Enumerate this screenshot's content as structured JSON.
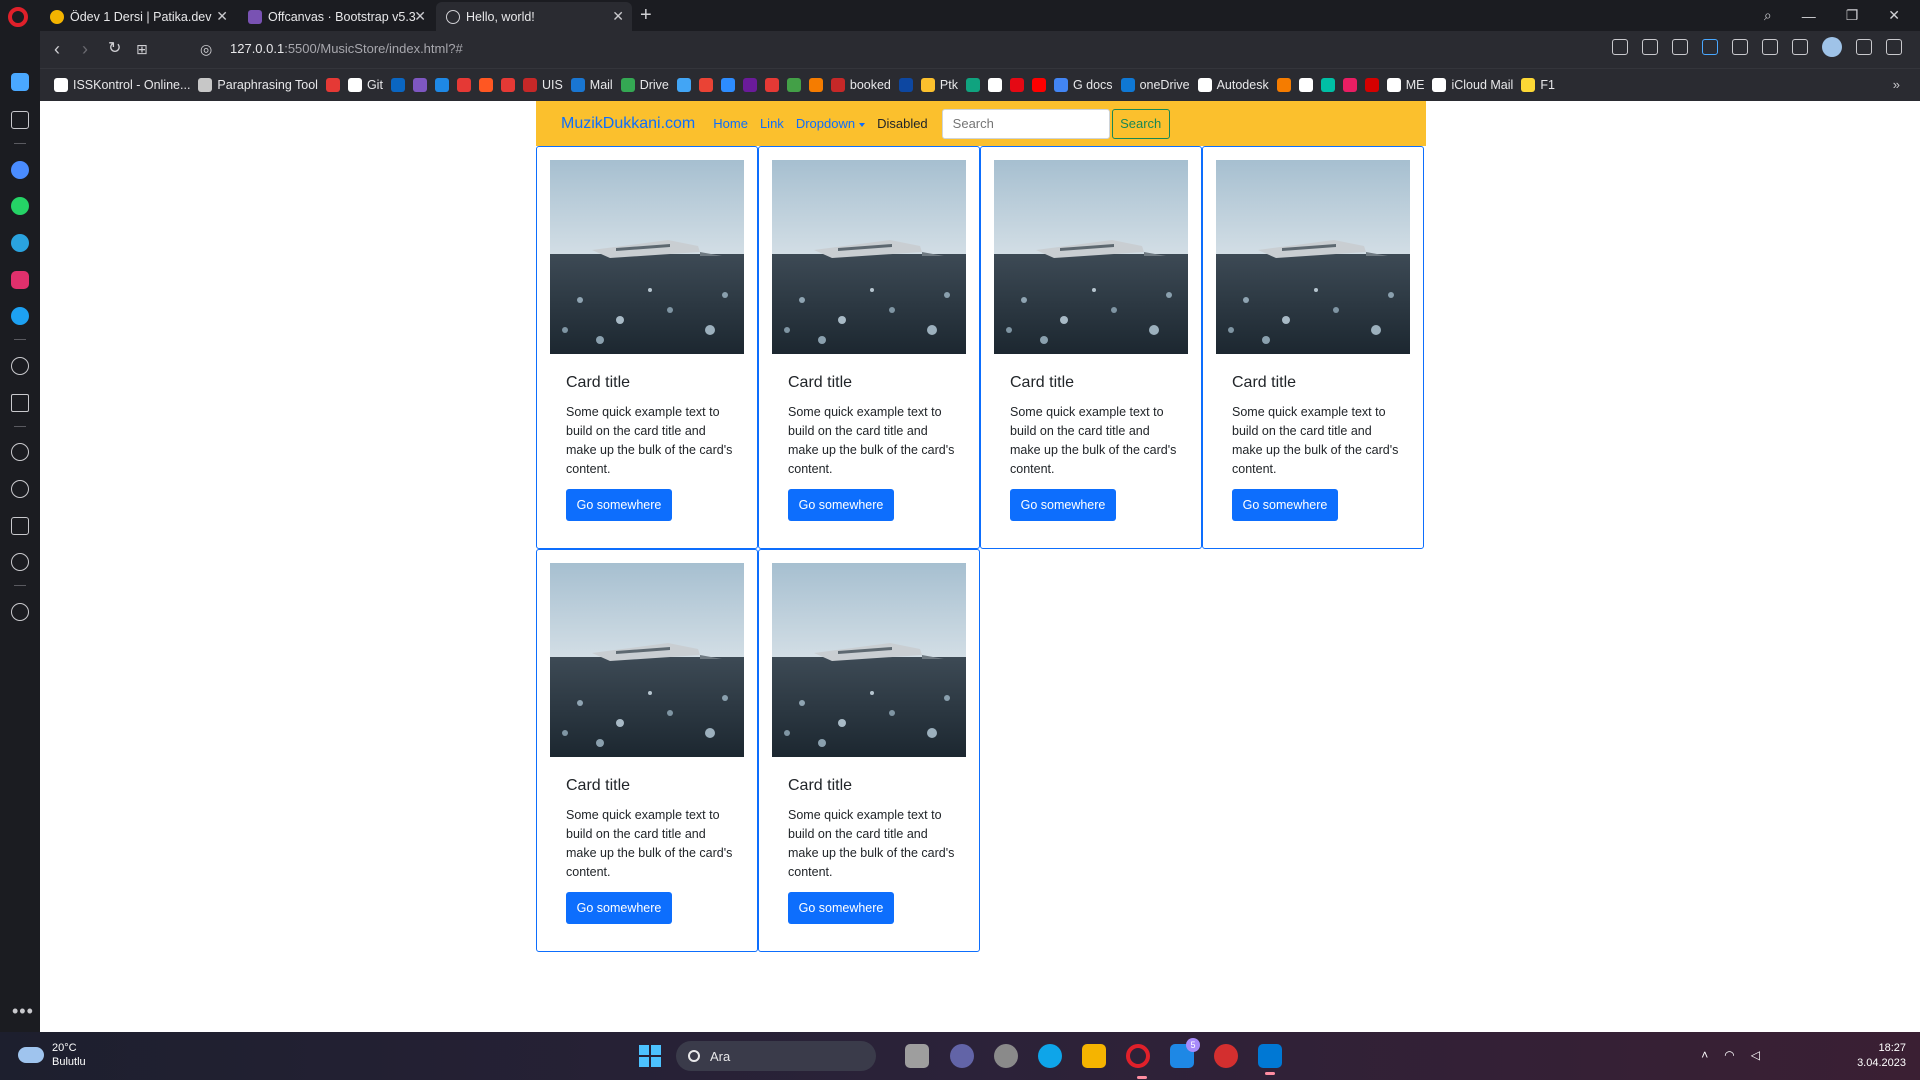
{
  "browser": {
    "tabs": [
      {
        "label": "Ödev 1 Dersi | Patika.dev",
        "favicon_color": "#f4b400",
        "active": false
      },
      {
        "label": "Offcanvas · Bootstrap v5.3",
        "favicon_color": "#7952b3",
        "active": false
      },
      {
        "label": "Hello, world!",
        "favicon_color": "#9aa0a6",
        "active": true
      }
    ],
    "url_host": "127.0.0.1",
    "url_path": ":5500/MusicStore/index.html?#",
    "bookmarks": [
      {
        "label": "ISSKontrol - Online...",
        "color": "#ffffff"
      },
      {
        "label": "Paraphrasing Tool",
        "color": "#c7c7c7"
      },
      {
        "label": "",
        "color": "#e53935"
      },
      {
        "label": "Git",
        "color": "#ffffff"
      },
      {
        "label": "",
        "color": "#0a66c2"
      },
      {
        "label": "",
        "color": "#7e57c2"
      },
      {
        "label": "",
        "color": "#1e88e5"
      },
      {
        "label": "",
        "color": "#e53935"
      },
      {
        "label": "",
        "color": "#ff5722"
      },
      {
        "label": "",
        "color": "#e53935"
      },
      {
        "label": "UIS",
        "color": "#c62828"
      },
      {
        "label": "Mail",
        "color": "#1976d2"
      },
      {
        "label": "Drive",
        "color": "#34a853"
      },
      {
        "label": "",
        "color": "#42a5f5"
      },
      {
        "label": "",
        "color": "#ea4335"
      },
      {
        "label": "",
        "color": "#2d8cff"
      },
      {
        "label": "",
        "color": "#6a1b9a"
      },
      {
        "label": "",
        "color": "#e53935"
      },
      {
        "label": "",
        "color": "#43a047"
      },
      {
        "label": "",
        "color": "#f57c00"
      },
      {
        "label": "booked",
        "color": "#c62828"
      },
      {
        "label": "",
        "color": "#0d47a1"
      },
      {
        "label": "Ptk",
        "color": "#fbc02d"
      },
      {
        "label": "",
        "color": "#10a37f"
      },
      {
        "label": "",
        "color": "#ffffff"
      },
      {
        "label": "",
        "color": "#e50914"
      },
      {
        "label": "",
        "color": "#ff0000"
      },
      {
        "label": "G docs",
        "color": "#4285f4"
      },
      {
        "label": "oneDrive",
        "color": "#0f78d4"
      },
      {
        "label": "Autodesk",
        "color": "#ffffff"
      },
      {
        "label": "",
        "color": "#f57c00"
      },
      {
        "label": "",
        "color": "#ffffff"
      },
      {
        "label": "",
        "color": "#00bfa5"
      },
      {
        "label": "",
        "color": "#e91e63"
      },
      {
        "label": "",
        "color": "#d50000"
      },
      {
        "label": "ME",
        "color": "#ffffff"
      },
      {
        "label": "iCloud Mail",
        "color": "#ffffff"
      },
      {
        "label": "F1",
        "color": "#fdd835"
      }
    ],
    "bookmarks_more": "»"
  },
  "page": {
    "brand": "MuzikDukkani.com",
    "nav_links": [
      {
        "label": "Home",
        "type": "link"
      },
      {
        "label": "Link",
        "type": "link"
      },
      {
        "label": "Dropdown",
        "type": "dropdown"
      },
      {
        "label": "Disabled",
        "type": "disabled"
      }
    ],
    "search": {
      "placeholder": "Search",
      "button_label": "Search"
    },
    "cards": [
      {
        "title": "Card title",
        "text": "Some quick example text to build on the card title and make up the bulk of the card's content.",
        "button": "Go somewhere"
      },
      {
        "title": "Card title",
        "text": "Some quick example text to build on the card title and make up the bulk of the card's content.",
        "button": "Go somewhere"
      },
      {
        "title": "Card title",
        "text": "Some quick example text to build on the card title and make up the bulk of the card's content.",
        "button": "Go somewhere"
      },
      {
        "title": "Card title",
        "text": "Some quick example text to build on the card title and make up the bulk of the card's content.",
        "button": "Go somewhere"
      },
      {
        "title": "Card title",
        "text": "Some quick example text to build on the card title and make up the bulk of the card's content.",
        "button": "Go somewhere"
      },
      {
        "title": "Card title",
        "text": "Some quick example text to build on the card title and make up the bulk of the card's content.",
        "button": "Go somewhere"
      }
    ],
    "colors": {
      "navbar_bg": "#fbc02d",
      "primary": "#0d6efd",
      "success": "#198754"
    }
  },
  "taskbar": {
    "weather_temp": "20°C",
    "weather_desc": "Bulutlu",
    "search_label": "Ara",
    "mail_badge": "5",
    "time": "18:27",
    "date": "3.04.2023"
  }
}
